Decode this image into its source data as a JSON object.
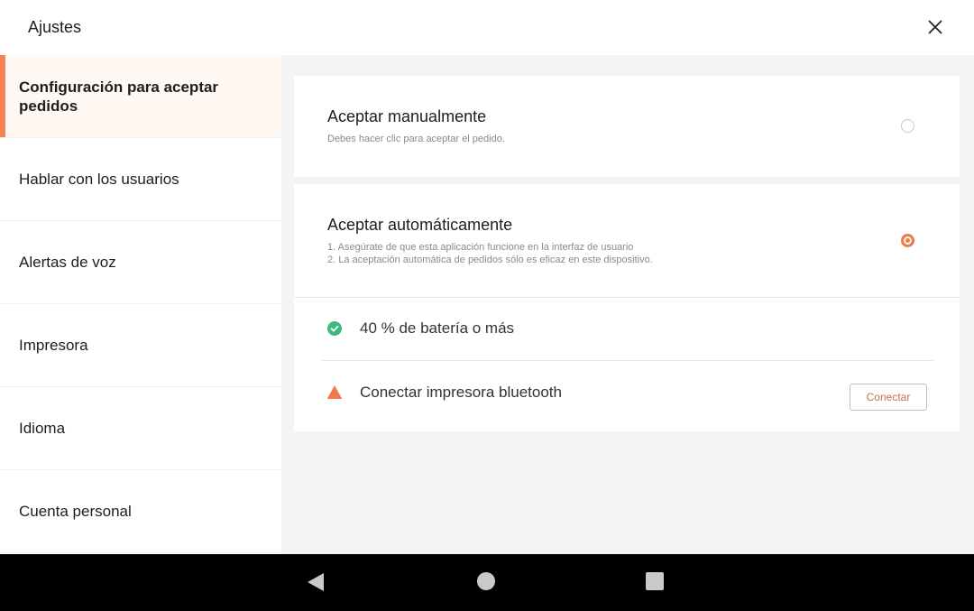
{
  "header": {
    "title": "Ajustes",
    "close_icon": "close-icon"
  },
  "sidebar": {
    "items": [
      {
        "label": "Configuración para aceptar pedidos",
        "active": true
      },
      {
        "label": "Hablar con los usuarios",
        "active": false
      },
      {
        "label": "Alertas de voz",
        "active": false
      },
      {
        "label": "Impresora",
        "active": false
      },
      {
        "label": "Idioma",
        "active": false
      },
      {
        "label": "Cuenta personal",
        "active": false
      }
    ]
  },
  "main": {
    "manual": {
      "title": "Aceptar manualmente",
      "description": "Debes hacer clic para aceptar el pedido.",
      "selected": false
    },
    "auto": {
      "title": "Aceptar automáticamente",
      "note_1": "1. Asegúrate de que esta aplicación funcione en la interfaz de usuario",
      "note_2": "2. La aceptación automática de pedidos sólo es eficaz en este dispositivo.",
      "selected": true
    },
    "requirements": [
      {
        "label": "40 % de batería o más",
        "status": "ok",
        "icon": "check-circle-icon"
      },
      {
        "label": "Conectar impresora bluetooth",
        "status": "warning",
        "icon": "warning-triangle-icon"
      }
    ],
    "connect_label": "Conectar"
  },
  "colors": {
    "accent": "#f5834f",
    "ok": "#3dba7e",
    "warning": "#f17a4c"
  },
  "navbar": {
    "icons": [
      "back-icon",
      "home-icon",
      "recent-apps-icon"
    ]
  }
}
